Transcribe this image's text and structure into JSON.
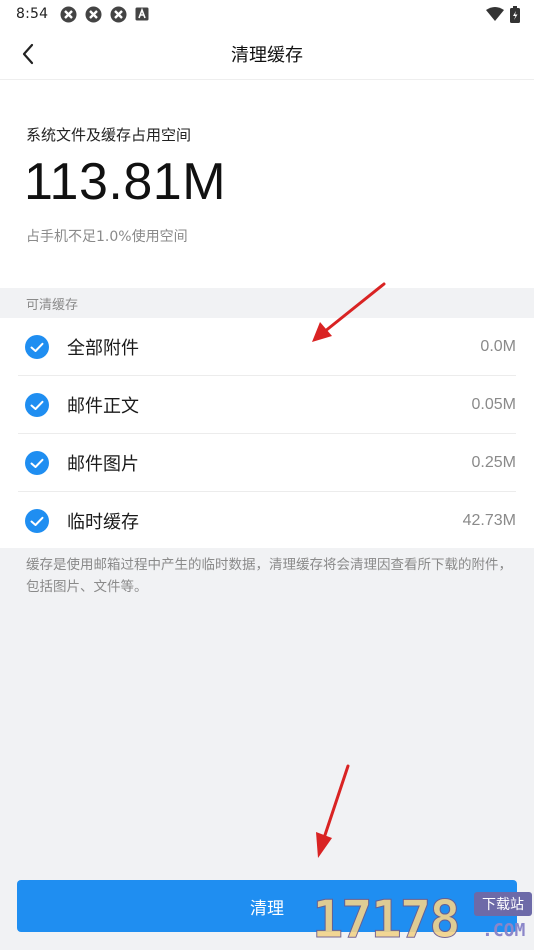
{
  "status_bar": {
    "time": "8:54",
    "notification_icons": [
      "app-notification-icon",
      "app-notification-icon",
      "app-notification-icon",
      "a-letter-icon"
    ],
    "right_icons": [
      "wifi-icon",
      "battery-icon"
    ]
  },
  "header": {
    "title": "清理缓存",
    "back_icon": "chevron-left-icon"
  },
  "summary": {
    "label": "系统文件及缓存占用空间",
    "size": "113.81M",
    "note": "占手机不足1.0%使用空间"
  },
  "section": {
    "title": "可清缓存"
  },
  "items": [
    {
      "label": "全部附件",
      "size": "0.0M",
      "checked": true
    },
    {
      "label": "邮件正文",
      "size": "0.05M",
      "checked": true
    },
    {
      "label": "邮件图片",
      "size": "0.25M",
      "checked": true
    },
    {
      "label": "临时缓存",
      "size": "42.73M",
      "checked": true
    }
  ],
  "description": "缓存是使用邮箱过程中产生的临时数据，清理缓存将会清理因查看所下载的附件，包括图片、文件等。",
  "button": {
    "label": "清理"
  },
  "watermark": {
    "digits": "17178",
    "badge": "下载站",
    "domain": ".COM"
  },
  "colors": {
    "accent": "#1f8ef1",
    "annotation_arrow": "#d92323",
    "secondary_text": "#8a8a8a",
    "background": "#f1f2f4"
  }
}
